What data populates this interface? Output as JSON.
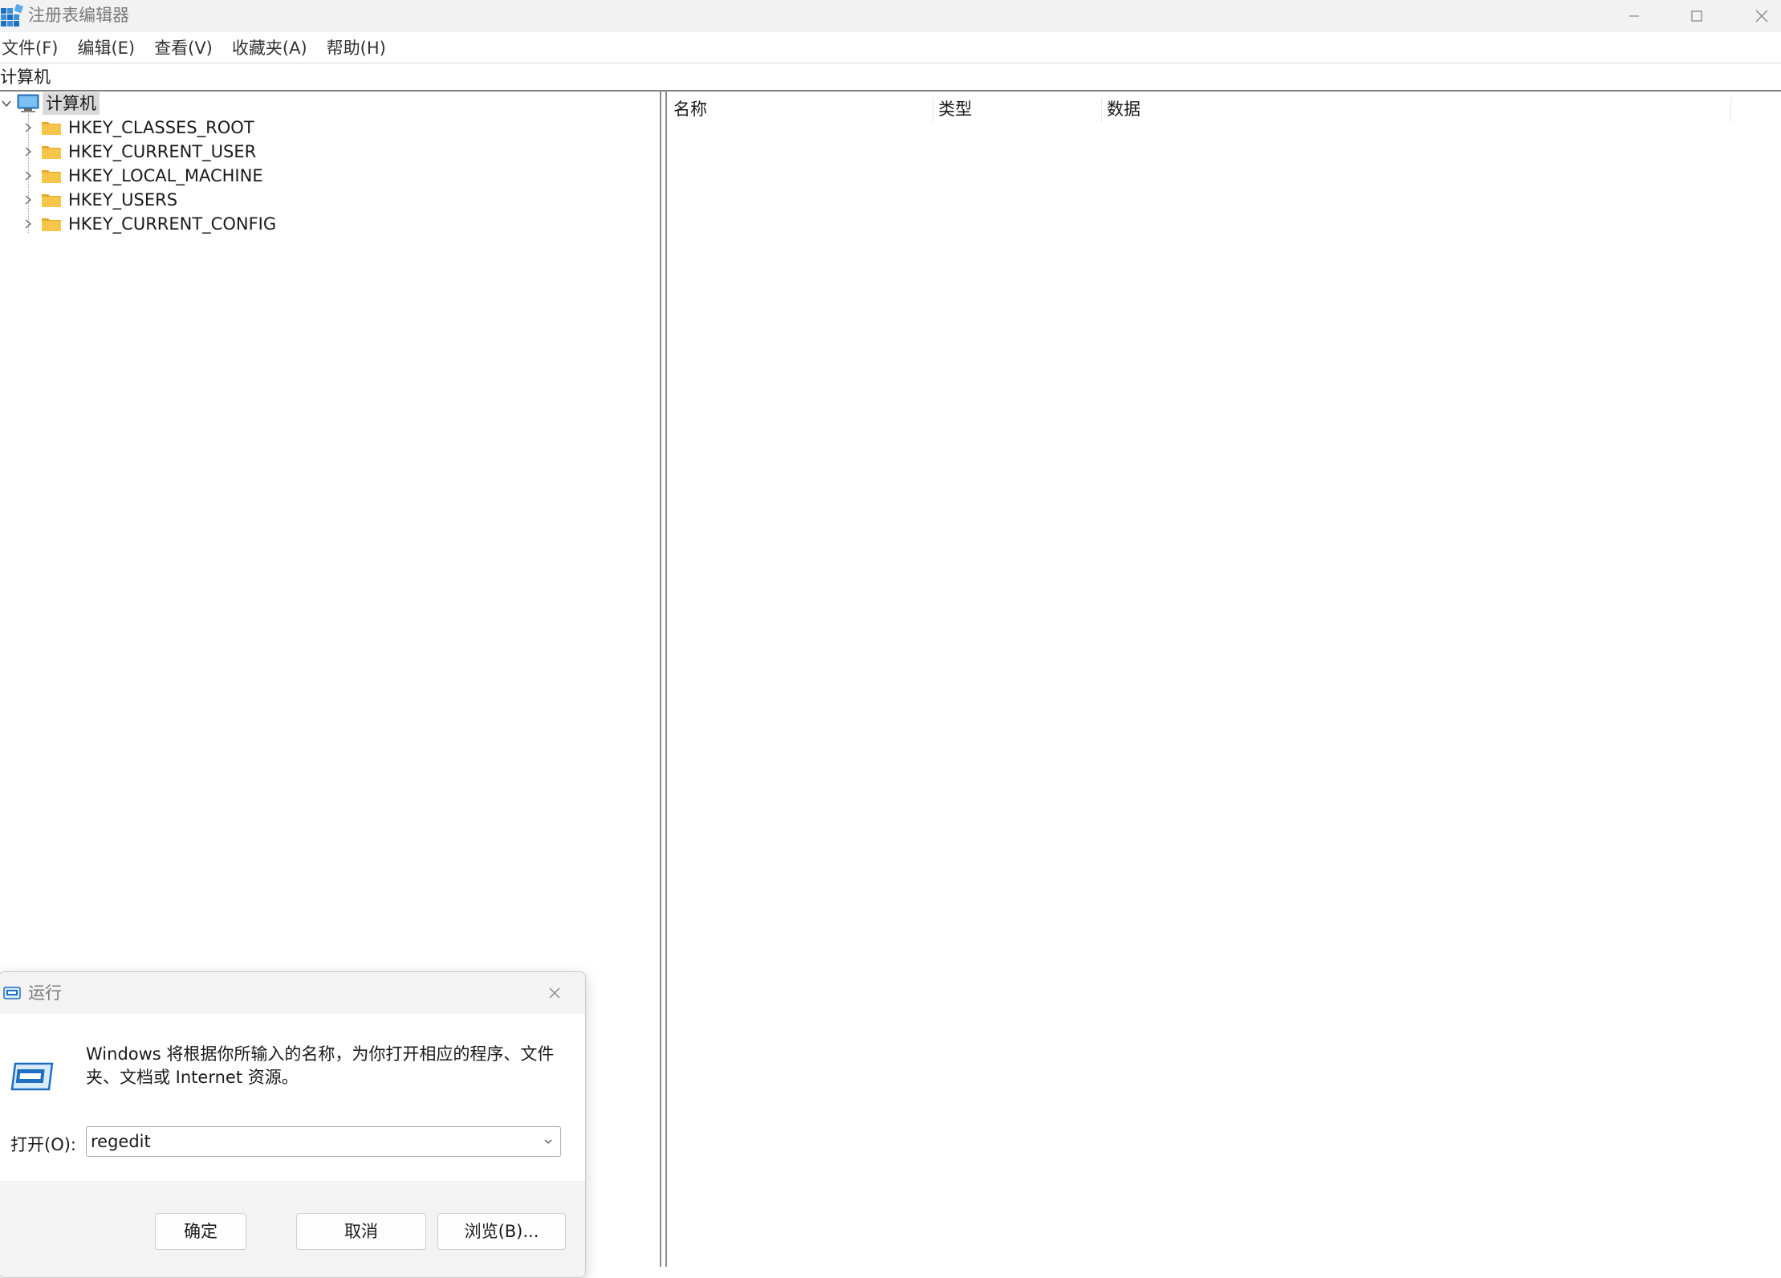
{
  "window": {
    "title": "注册表编辑器"
  },
  "menu": [
    {
      "label": "文件(F)"
    },
    {
      "label": "编辑(E)"
    },
    {
      "label": "查看(V)"
    },
    {
      "label": "收藏夹(A)"
    },
    {
      "label": "帮助(H)"
    }
  ],
  "address": "计算机",
  "tree": {
    "root": "计算机",
    "hives": [
      {
        "label": "HKEY_CLASSES_ROOT"
      },
      {
        "label": "HKEY_CURRENT_USER"
      },
      {
        "label": "HKEY_LOCAL_MACHINE"
      },
      {
        "label": "HKEY_USERS"
      },
      {
        "label": "HKEY_CURRENT_CONFIG"
      }
    ]
  },
  "list": {
    "columns": [
      "名称",
      "类型",
      "数据"
    ]
  },
  "run_dialog": {
    "title": "运行",
    "description": "Windows 将根据你所输入的名称，为你打开相应的程序、文件夹、文档或 Internet 资源。",
    "open_label": "打开(O):",
    "open_value": "regedit",
    "ok": "确定",
    "cancel": "取消",
    "browse": "浏览(B)..."
  },
  "colors": {
    "folder": "#f6c54a",
    "folder_dark": "#e2a92b",
    "computer_screen": "#3a8fd6",
    "selection": "#d9d9d9"
  },
  "icons": {
    "app": "registry-editor-icon",
    "computer": "computer-icon",
    "folder": "folder-icon",
    "run": "run-icon"
  }
}
